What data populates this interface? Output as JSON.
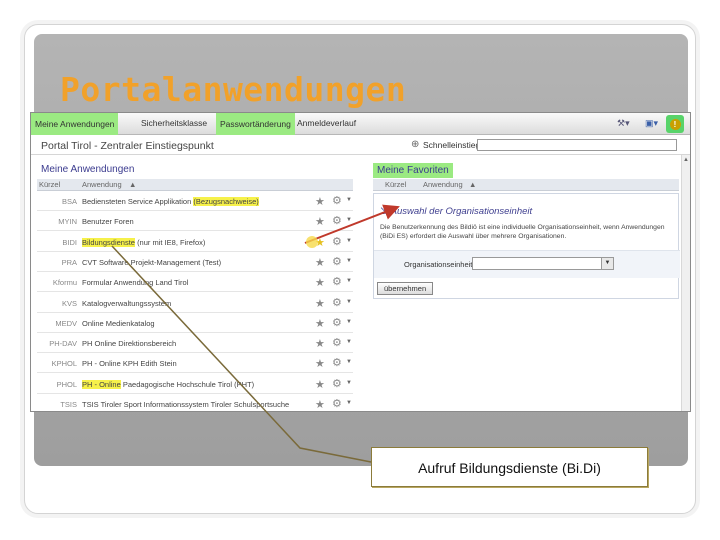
{
  "slide": {
    "title": "Portalanwendungen",
    "caption": "Aufruf Bildungsdienste (Bi.Di)"
  },
  "topnav": {
    "items": [
      {
        "label": "Meine Anwendungen",
        "active": true
      },
      {
        "label": "Sicherheitsklasse",
        "active": false
      },
      {
        "label": "Passwortänderung",
        "active": true
      },
      {
        "label": "Anmeldeverlauf",
        "active": false
      }
    ],
    "help_glyph": "!"
  },
  "header": {
    "portal_title": "Portal Tirol - Zentraler Einstiegspunkt",
    "quick_entry_label": "Schnelleinstieg",
    "quick_entry_value": ""
  },
  "my_apps": {
    "title": "Meine Anwendungen",
    "columns": [
      "Kürzel",
      "Anwendung"
    ],
    "rows": [
      {
        "code": "BSA",
        "name": "Bediensteten Service Applikation",
        "extra": "(Bezugsnachweise)",
        "name_highlight": false,
        "extra_highlight": true,
        "star_active": false
      },
      {
        "code": "MYIN",
        "name": "Benutzer Foren",
        "extra": "",
        "name_highlight": false,
        "extra_highlight": false,
        "star_active": false
      },
      {
        "code": "BIDI",
        "name": "Bildungsdienste",
        "extra": "(nur mit IE8, Firefox)",
        "name_highlight": true,
        "extra_highlight": false,
        "star_active": true
      },
      {
        "code": "PRA",
        "name": "CVT Software Projekt-Management (Test)",
        "extra": "",
        "name_highlight": false,
        "extra_highlight": false,
        "star_active": false
      },
      {
        "code": "Kformu",
        "name": "Formular Anwendung Land Tirol",
        "extra": "",
        "name_highlight": false,
        "extra_highlight": false,
        "star_active": false
      },
      {
        "code": "KVS",
        "name": "Katalogverwaltungssystem",
        "extra": "",
        "name_highlight": false,
        "extra_highlight": false,
        "star_active": false
      },
      {
        "code": "MEDV",
        "name": "Online Medienkatalog",
        "extra": "",
        "name_highlight": false,
        "extra_highlight": false,
        "star_active": false
      },
      {
        "code": "PH-DAV",
        "name": "PH Online Direktionsbereich",
        "extra": "",
        "name_highlight": false,
        "extra_highlight": false,
        "star_active": false
      },
      {
        "code": "KPHOL",
        "name": "PH - Online KPH Edith Stein",
        "extra": "",
        "name_highlight": false,
        "extra_highlight": false,
        "star_active": false
      },
      {
        "code": "PHOL",
        "name": "PH - Online",
        "extra": "Paedagogische Hochschule Tirol (PHT)",
        "name_highlight": true,
        "extra_highlight": false,
        "star_active": false
      },
      {
        "code": "TSIS",
        "name": "TSIS Tiroler Sport Informationssystem",
        "extra": "Tiroler Schulsportsuche",
        "name_highlight": false,
        "extra_highlight": false,
        "star_active": false
      }
    ]
  },
  "favorites": {
    "title": "Meine Favoriten",
    "columns": [
      "Kürzel",
      "Anwendung"
    ],
    "org_panel": {
      "header": "Auswahl der Organisationseinheit",
      "description": "Die Benutzerkennung des Bildiö ist eine individuelle Organisationseinheit, wenn Anwendungen (BiDi ES) erfordert die Auswahl über mehrere Organisationen.",
      "field_label": "Organisationseinheit",
      "field_value": ""
    },
    "submit_label": "übernehmen"
  },
  "colors": {
    "title_orange": "#f1a12a",
    "highlight_green": "#9bea82",
    "highlight_yellow": "#f6f14a",
    "arrow_red": "#c0392b",
    "line_brown": "#7a6a3a"
  }
}
